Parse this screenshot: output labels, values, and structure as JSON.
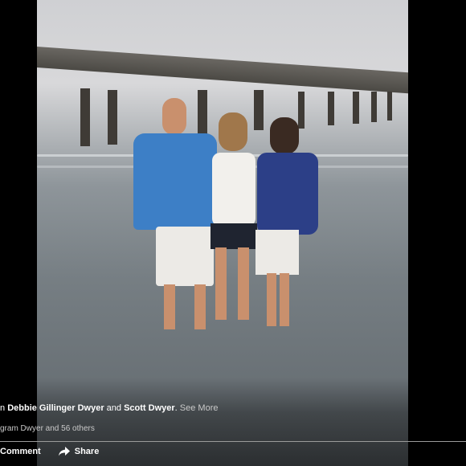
{
  "post": {
    "caption": {
      "prefix": "n",
      "tag1": "Debbie Gillinger Dwyer",
      "joiner": " and ",
      "tag2": "Scott Dwyer",
      "end": ". ",
      "see_more": "See More"
    },
    "likes_text": "gram Dwyer and 56 others"
  },
  "actions": {
    "comment_label": "Comment",
    "share_label": "Share"
  },
  "colors": {
    "background": "#000000",
    "text": "#ffffff",
    "muted": "#c9c9c9"
  },
  "icons": [
    "share-icon"
  ]
}
